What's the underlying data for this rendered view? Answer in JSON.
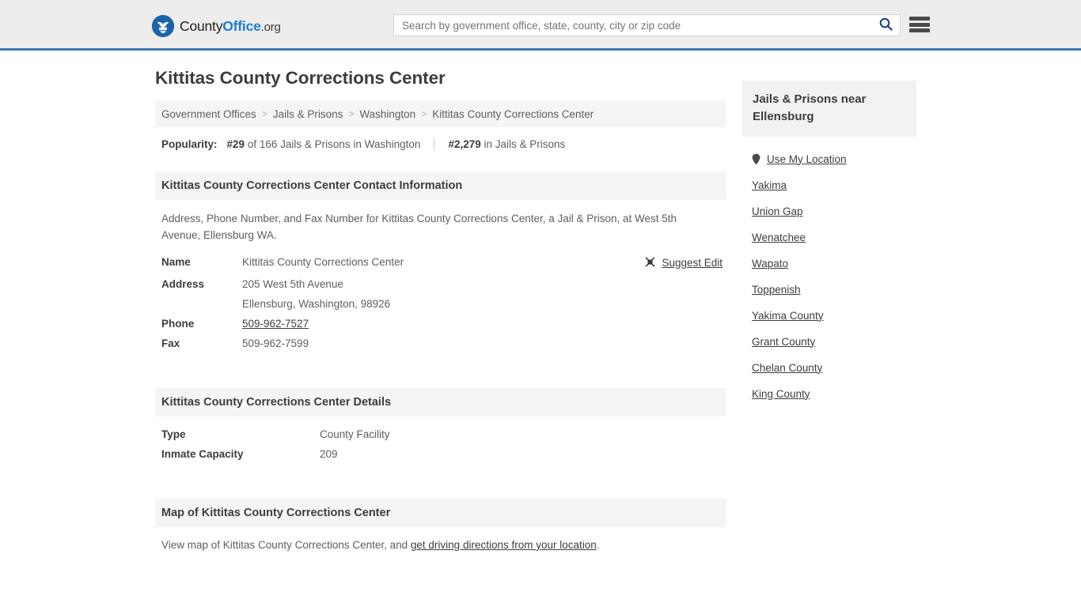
{
  "header": {
    "brand": {
      "part1": "County",
      "part2": "Office",
      "part3": ".org",
      "logo_icon": "eagle-shield-icon"
    },
    "search": {
      "placeholder": "Search by government office, state, county, city or zip code",
      "value": "",
      "icon": "search-icon"
    },
    "menu_icon": "hamburger-menu-icon",
    "accent_color": "#3d7ab0",
    "background_color": "#efedec"
  },
  "page": {
    "title": "Kittitas County Corrections Center"
  },
  "breadcrumb": {
    "separator": ">",
    "items": [
      {
        "label": "Government Offices",
        "current": false
      },
      {
        "label": "Jails & Prisons",
        "current": false
      },
      {
        "label": "Washington",
        "current": false
      },
      {
        "label": "Kittitas County Corrections Center",
        "current": true
      }
    ]
  },
  "popularity": {
    "label": "Popularity:",
    "stat1_rank": "#29",
    "stat1_text": "of 166 Jails & Prisons in Washington",
    "stat2_rank": "#2,279",
    "stat2_text": "in Jails & Prisons"
  },
  "contact": {
    "heading": "Kittitas County Corrections Center Contact Information",
    "intro": "Address, Phone Number, and Fax Number for Kittitas County Corrections Center, a Jail & Prison, at West 5th Avenue, Ellensburg WA.",
    "suggest_edit": {
      "label": "Suggest Edit",
      "icon": "edit-pencil-icon"
    },
    "rows": [
      {
        "key": "Name",
        "value": "Kittitas County Corrections Center"
      },
      {
        "key": "Address",
        "value": "205 West 5th Avenue"
      },
      {
        "key": "",
        "value": "Ellensburg, Washington, 98926"
      },
      {
        "key": "Phone",
        "value": "509-962-7527"
      },
      {
        "key": "Fax",
        "value": "509-962-7599"
      }
    ]
  },
  "details": {
    "heading": "Kittitas County Corrections Center Details",
    "rows": [
      {
        "key": "Type",
        "value": "County Facility"
      },
      {
        "key": "Inmate Capacity",
        "value": "209"
      }
    ]
  },
  "map": {
    "heading": "Map of Kittitas County Corrections Center",
    "text_before": "View map of Kittitas County Corrections Center, and ",
    "link_label": "get driving directions from your location",
    "text_after": "."
  },
  "sidebar": {
    "heading": "Jails & Prisons near Ellensburg",
    "use_my_location": {
      "label": "Use My Location",
      "icon": "map-pin-icon"
    },
    "links": [
      {
        "label": "Yakima"
      },
      {
        "label": "Union Gap"
      },
      {
        "label": "Wenatchee"
      },
      {
        "label": "Wapato"
      },
      {
        "label": "Toppenish"
      },
      {
        "label": "Yakima County"
      },
      {
        "label": "Grant County"
      },
      {
        "label": "Chelan County"
      },
      {
        "label": "King County"
      }
    ]
  }
}
